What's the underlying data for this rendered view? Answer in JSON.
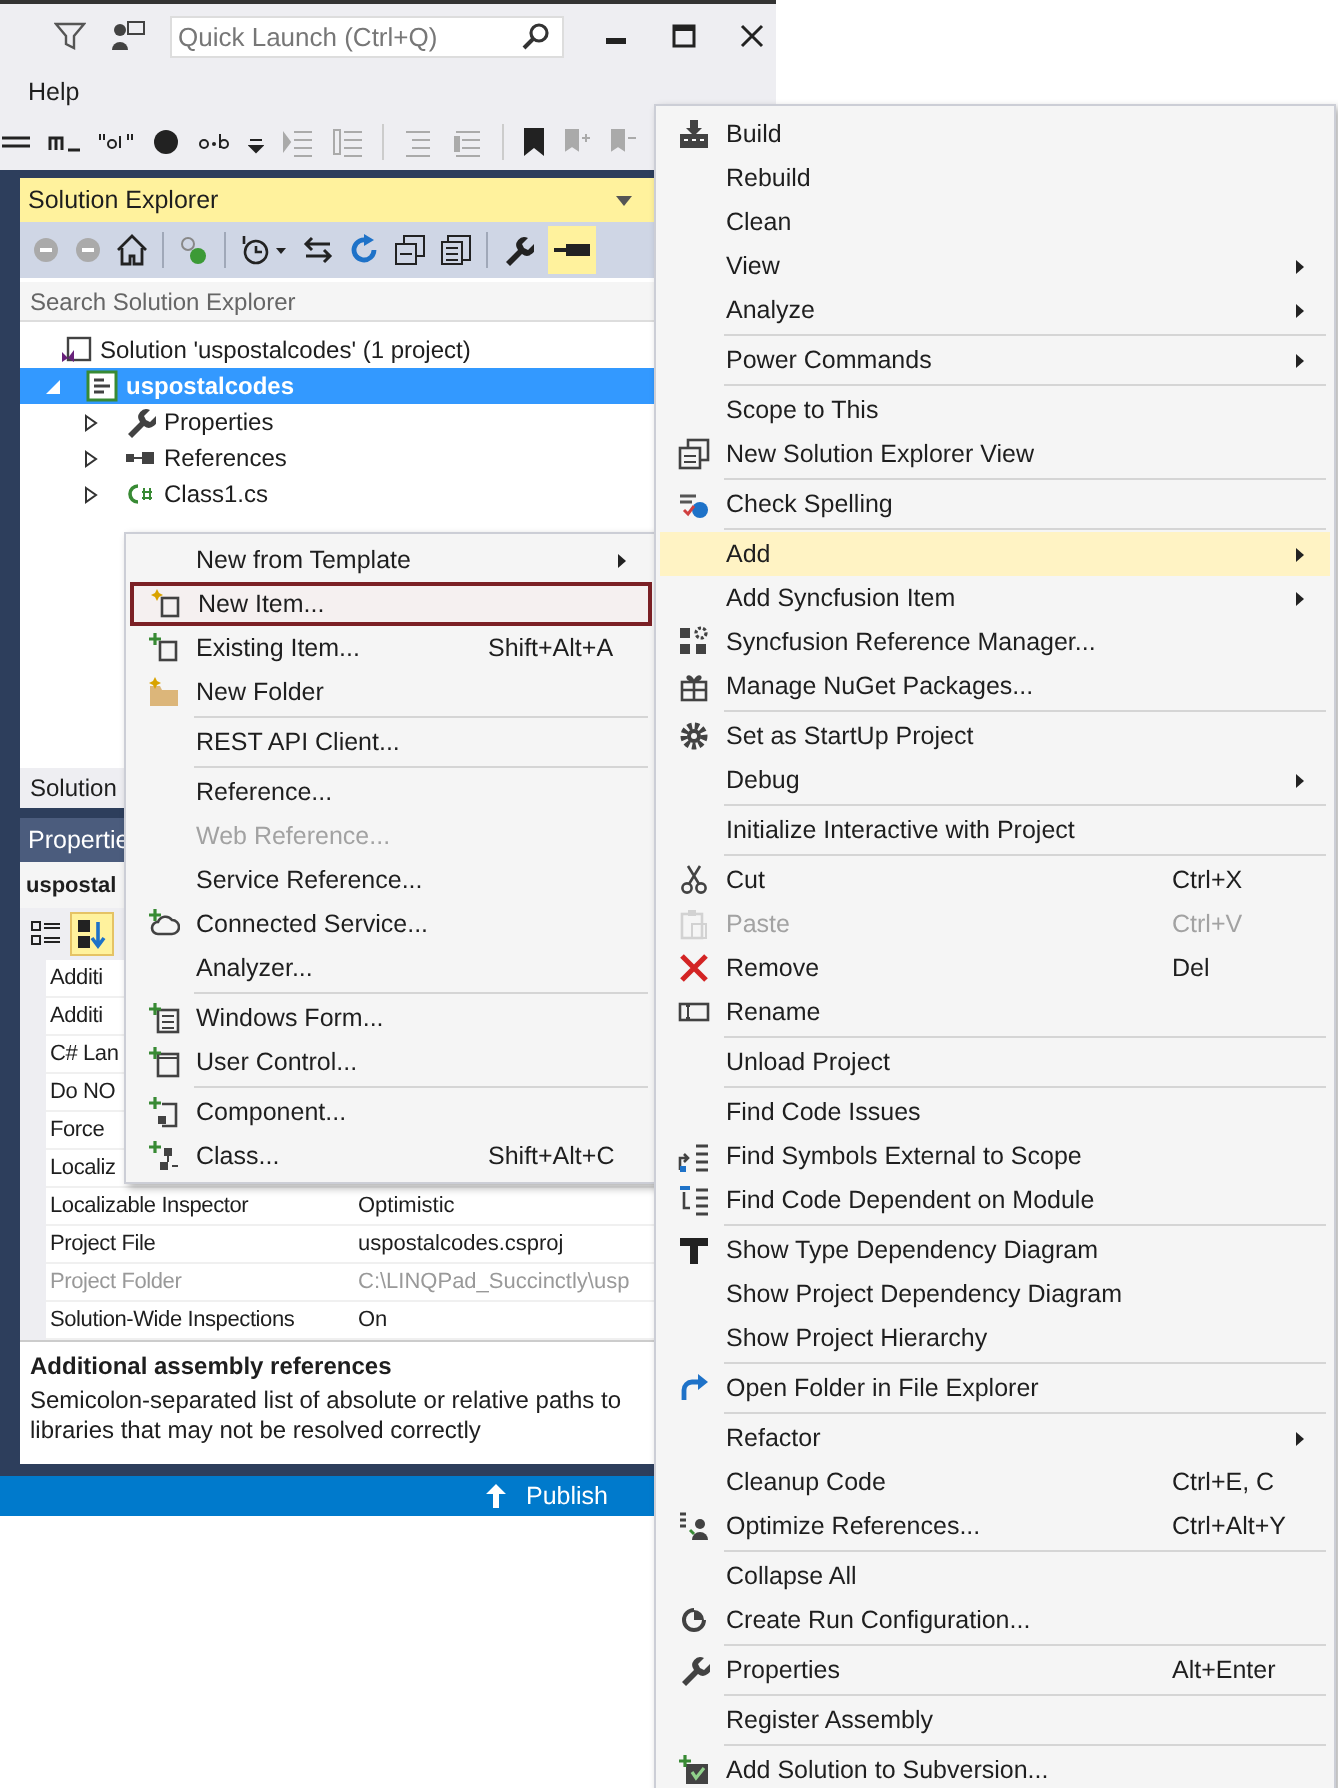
{
  "title_bar": {
    "quick_launch": {
      "placeholder": "Quick Launch (Ctrl+Q)"
    }
  },
  "menu_bar": [
    {
      "label": "Help"
    }
  ],
  "solution_explorer": {
    "title": "Solution Explorer",
    "search": {
      "placeholder": "Search Solution Explorer"
    },
    "tree": [
      {
        "label": "Solution 'uspostalcodes' (1 project)",
        "kind": "solution",
        "selected": false,
        "children": [
          {
            "label": "uspostalcodes",
            "kind": "project",
            "selected": true,
            "expanded": true,
            "children": [
              {
                "label": "Properties",
                "kind": "properties",
                "selected": false,
                "expanded": false
              },
              {
                "label": "References",
                "kind": "references",
                "selected": false,
                "expanded": false
              },
              {
                "label": "Class1.cs",
                "kind": "csharp",
                "selected": false,
                "expanded": false
              }
            ]
          }
        ]
      }
    ],
    "tab_label": "Solution"
  },
  "properties": {
    "title": "Propertie",
    "object": "uspostal",
    "rows": [
      {
        "name": "Additi",
        "disabled": false
      },
      {
        "name": "Additi",
        "disabled": false
      },
      {
        "name": "C# Lan",
        "disabled": false
      },
      {
        "name": "Do NO",
        "disabled": false
      },
      {
        "name": "Force",
        "disabled": false
      },
      {
        "name": "Localiz",
        "disabled": false
      },
      {
        "name": "Localizable Inspector",
        "value": "Optimistic",
        "disabled": false
      },
      {
        "name": "Project File",
        "value": "uspostalcodes.csproj",
        "disabled": false
      },
      {
        "name": "Project Folder",
        "value": "C:\\LINQPad_Succinctly\\usp",
        "disabled": true
      },
      {
        "name": "Solution-Wide Inspections",
        "value": "On",
        "disabled": false
      }
    ],
    "description": {
      "title": "Additional assembly references",
      "text": "Semicolon-separated list of absolute or relative paths to libraries that may not be resolved correctly"
    }
  },
  "status_bar": {
    "publish": "Publish"
  },
  "add_menu": {
    "items": [
      {
        "kind": "item",
        "label": "New from Template",
        "submenu": true,
        "selected": false,
        "disabled": false
      },
      {
        "kind": "item",
        "label": "New Item...",
        "selected": true,
        "disabled": false
      },
      {
        "kind": "item",
        "label": "Existing Item...",
        "shortcut": "Shift+Alt+A",
        "selected": false,
        "disabled": false
      },
      {
        "kind": "item",
        "label": "New Folder",
        "selected": false,
        "disabled": false
      },
      {
        "kind": "separator"
      },
      {
        "kind": "item",
        "label": "REST API Client...",
        "selected": false,
        "disabled": false
      },
      {
        "kind": "separator"
      },
      {
        "kind": "item",
        "label": "Reference...",
        "selected": false,
        "disabled": false
      },
      {
        "kind": "item",
        "label": "Web Reference...",
        "selected": false,
        "disabled": true
      },
      {
        "kind": "item",
        "label": "Service Reference...",
        "selected": false,
        "disabled": false
      },
      {
        "kind": "item",
        "label": "Connected Service...",
        "selected": false,
        "disabled": false
      },
      {
        "kind": "item",
        "label": "Analyzer...",
        "selected": false,
        "disabled": false
      },
      {
        "kind": "separator"
      },
      {
        "kind": "item",
        "label": "Windows Form...",
        "selected": false,
        "disabled": false
      },
      {
        "kind": "item",
        "label": "User Control...",
        "selected": false,
        "disabled": false
      },
      {
        "kind": "separator"
      },
      {
        "kind": "item",
        "label": "Component...",
        "selected": false,
        "disabled": false
      },
      {
        "kind": "item",
        "label": "Class...",
        "shortcut": "Shift+Alt+C",
        "selected": false,
        "disabled": false
      }
    ]
  },
  "project_menu": {
    "items": [
      {
        "kind": "item",
        "label": "Build",
        "selected": false,
        "disabled": false
      },
      {
        "kind": "item",
        "label": "Rebuild",
        "selected": false,
        "disabled": false
      },
      {
        "kind": "item",
        "label": "Clean",
        "selected": false,
        "disabled": false
      },
      {
        "kind": "item",
        "label": "View",
        "submenu": true,
        "selected": false,
        "disabled": false
      },
      {
        "kind": "item",
        "label": "Analyze",
        "submenu": true,
        "selected": false,
        "disabled": false
      },
      {
        "kind": "separator"
      },
      {
        "kind": "item",
        "label": "Power Commands",
        "submenu": true,
        "selected": false,
        "disabled": false
      },
      {
        "kind": "separator"
      },
      {
        "kind": "item",
        "label": "Scope to This",
        "selected": false,
        "disabled": false
      },
      {
        "kind": "item",
        "label": "New Solution Explorer View",
        "selected": false,
        "disabled": false
      },
      {
        "kind": "separator"
      },
      {
        "kind": "item",
        "label": "Check Spelling",
        "selected": false,
        "disabled": false
      },
      {
        "kind": "separator"
      },
      {
        "kind": "item",
        "label": "Add",
        "submenu": true,
        "selected": true,
        "disabled": false
      },
      {
        "kind": "item",
        "label": "Add Syncfusion Item",
        "submenu": true,
        "selected": false,
        "disabled": false
      },
      {
        "kind": "item",
        "label": "Syncfusion Reference Manager...",
        "selected": false,
        "disabled": false
      },
      {
        "kind": "item",
        "label": "Manage NuGet Packages...",
        "selected": false,
        "disabled": false
      },
      {
        "kind": "separator"
      },
      {
        "kind": "item",
        "label": "Set as StartUp Project",
        "selected": false,
        "disabled": false
      },
      {
        "kind": "item",
        "label": "Debug",
        "submenu": true,
        "selected": false,
        "disabled": false
      },
      {
        "kind": "separator"
      },
      {
        "kind": "item",
        "label": "Initialize Interactive with Project",
        "selected": false,
        "disabled": false
      },
      {
        "kind": "separator"
      },
      {
        "kind": "item",
        "label": "Cut",
        "shortcut": "Ctrl+X",
        "selected": false,
        "disabled": false
      },
      {
        "kind": "item",
        "label": "Paste",
        "shortcut": "Ctrl+V",
        "selected": false,
        "disabled": true
      },
      {
        "kind": "item",
        "label": "Remove",
        "shortcut": "Del",
        "selected": false,
        "disabled": false
      },
      {
        "kind": "item",
        "label": "Rename",
        "selected": false,
        "disabled": false
      },
      {
        "kind": "separator"
      },
      {
        "kind": "item",
        "label": "Unload Project",
        "selected": false,
        "disabled": false
      },
      {
        "kind": "separator"
      },
      {
        "kind": "item",
        "label": "Find Code Issues",
        "selected": false,
        "disabled": false
      },
      {
        "kind": "item",
        "label": "Find Symbols External to Scope",
        "selected": false,
        "disabled": false
      },
      {
        "kind": "item",
        "label": "Find Code Dependent on Module",
        "selected": false,
        "disabled": false
      },
      {
        "kind": "separator"
      },
      {
        "kind": "item",
        "label": "Show Type Dependency Diagram",
        "selected": false,
        "disabled": false
      },
      {
        "kind": "item",
        "label": "Show Project Dependency Diagram",
        "selected": false,
        "disabled": false
      },
      {
        "kind": "item",
        "label": "Show Project Hierarchy",
        "selected": false,
        "disabled": false
      },
      {
        "kind": "separator"
      },
      {
        "kind": "item",
        "label": "Open Folder in File Explorer",
        "selected": false,
        "disabled": false
      },
      {
        "kind": "separator"
      },
      {
        "kind": "item",
        "label": "Refactor",
        "submenu": true,
        "selected": false,
        "disabled": false
      },
      {
        "kind": "item",
        "label": "Cleanup Code",
        "shortcut": "Ctrl+E, C",
        "selected": false,
        "disabled": false
      },
      {
        "kind": "item",
        "label": "Optimize References...",
        "shortcut": "Ctrl+Alt+Y",
        "selected": false,
        "disabled": false
      },
      {
        "kind": "separator"
      },
      {
        "kind": "item",
        "label": "Collapse All",
        "selected": false,
        "disabled": false
      },
      {
        "kind": "item",
        "label": "Create Run Configuration...",
        "selected": false,
        "disabled": false
      },
      {
        "kind": "separator"
      },
      {
        "kind": "item",
        "label": "Properties",
        "shortcut": "Alt+Enter",
        "selected": false,
        "disabled": false
      },
      {
        "kind": "separator"
      },
      {
        "kind": "item",
        "label": "Register Assembly",
        "selected": false,
        "disabled": false
      },
      {
        "kind": "separator"
      },
      {
        "kind": "item",
        "label": "Add Solution to Subversion...",
        "selected": false,
        "disabled": false
      }
    ]
  }
}
